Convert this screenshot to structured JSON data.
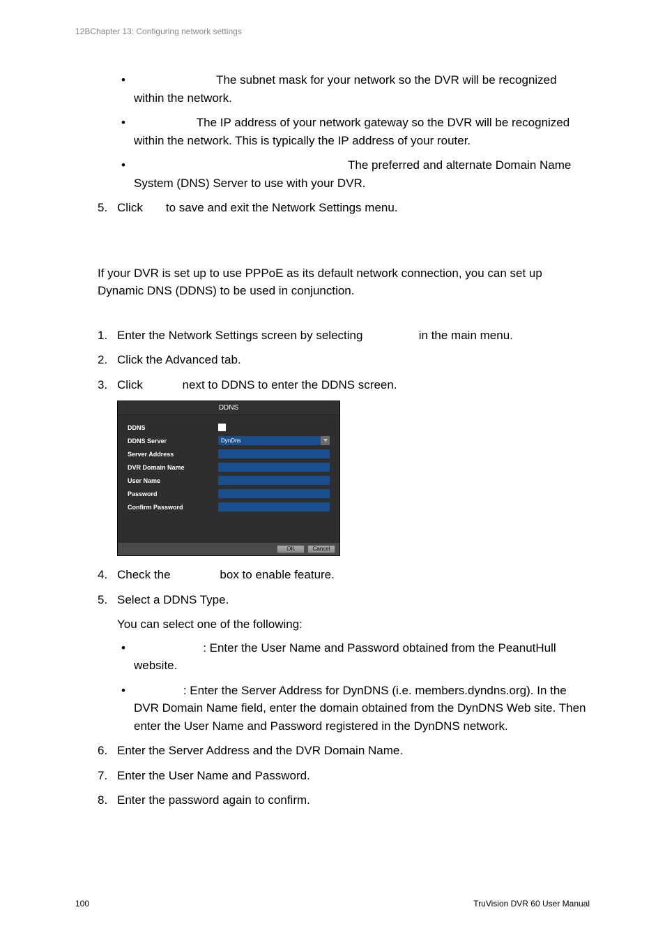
{
  "header": "12BChapter 13: Configuring network settings",
  "bullets_top": [
    "The subnet mask for your network so the DVR will be recognized within the network.",
    "The IP address of your network gateway so the DVR will be recognized within the network. This is typically the IP address of your router.",
    "The preferred and alternate Domain Name System (DNS) Server to use with your DVR."
  ],
  "step5_a": "Click",
  "step5_b": "to save and exit the Network Settings menu.",
  "intro_para": "If your DVR is set up to use PPPoE as its default network connection, you can set up Dynamic DNS (DDNS) to be used in conjunction.",
  "steps": {
    "s1_a": "Enter the Network Settings screen by selecting",
    "s1_b": "in the main menu.",
    "s2": "Click the Advanced tab.",
    "s3_a": "Click",
    "s3_b": "next to DDNS to enter the DDNS screen.",
    "s4_a": "Check the",
    "s4_b": "box to enable feature.",
    "s5": "Select a DDNS Type.",
    "s5_sub": "You can select one of the following:",
    "s5_b1": ": Enter the User Name and Password obtained from the PeanutHull website.",
    "s5_b2": ": Enter the Server Address for DynDNS (i.e. members.dyndns.org). In the DVR Domain Name field, enter the domain obtained from the DynDNS Web site. Then enter the User Name and Password registered in the DynDNS network.",
    "s6": "Enter the Server Address and the DVR Domain Name.",
    "s7": "Enter the User Name and Password.",
    "s8": "Enter the password again to confirm."
  },
  "ddns_modal": {
    "title": "DDNS",
    "labels": {
      "ddns": "DDNS",
      "server": "DDNS Server",
      "address": "Server Address",
      "domain": "DVR Domain Name",
      "user": "User Name",
      "password": "Password",
      "confirm": "Confirm Password"
    },
    "select_value": "DynDns",
    "buttons": {
      "ok": "OK",
      "cancel": "Cancel"
    }
  },
  "footer": {
    "page": "100",
    "manual": "TruVision DVR 60 User Manual"
  },
  "chart_data": {
    "type": "table",
    "title": "DDNS Settings Dialog",
    "fields": [
      {
        "label": "DDNS",
        "control": "checkbox",
        "value": false
      },
      {
        "label": "DDNS Server",
        "control": "select",
        "value": "DynDns"
      },
      {
        "label": "Server Address",
        "control": "text",
        "value": ""
      },
      {
        "label": "DVR Domain Name",
        "control": "text",
        "value": ""
      },
      {
        "label": "User Name",
        "control": "text",
        "value": ""
      },
      {
        "label": "Password",
        "control": "password",
        "value": ""
      },
      {
        "label": "Confirm Password",
        "control": "password",
        "value": ""
      }
    ],
    "buttons": [
      "OK",
      "Cancel"
    ]
  }
}
